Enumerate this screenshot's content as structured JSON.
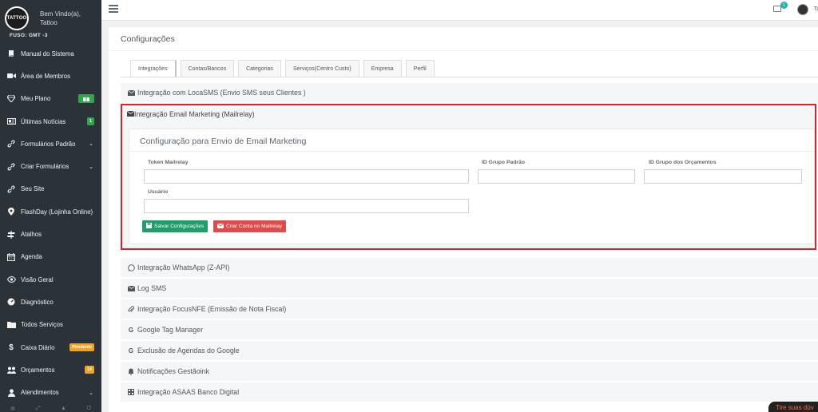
{
  "sidebar": {
    "logo_text": "TATTOO",
    "welcome_line1": "Bem Vindo(a),",
    "welcome_line2": "Tattoo",
    "timezone": "FUSO: GMT -3",
    "items": [
      {
        "label": "Manual do Sistema",
        "icon": "book-icon"
      },
      {
        "label": "Área de Membros",
        "icon": "video-icon"
      },
      {
        "label": "Meu Plano",
        "icon": "diamond-icon",
        "badge_icon": "gift-icon"
      },
      {
        "label": "Últimas Notícias",
        "icon": "newspaper-icon",
        "badge": "1"
      },
      {
        "label": "Formulários Padrão",
        "icon": "link-icon"
      },
      {
        "label": "Criar Formulários",
        "icon": "link-icon"
      },
      {
        "label": "Seu Site",
        "icon": "link-icon"
      },
      {
        "label": "FlashDay (Lojinha Online)",
        "icon": "map-marker-icon"
      },
      {
        "label": "Atalhos",
        "icon": "signpost-icon"
      },
      {
        "label": "Agenda",
        "icon": "calendar-icon"
      },
      {
        "label": "Visão Geral",
        "icon": "eye-icon"
      },
      {
        "label": "Diagnóstico",
        "icon": "gauge-icon"
      },
      {
        "label": "Todos Serviços",
        "icon": "folder-icon"
      },
      {
        "label": "Caixa Diário",
        "icon": "dollar-icon",
        "badge": "Pendente"
      },
      {
        "label": "Orçamentos",
        "icon": "users-icon",
        "badge": "14"
      },
      {
        "label": "Atendimentos",
        "icon": "user-icon"
      }
    ]
  },
  "topbar": {
    "mail_count": "1",
    "user_short": "Ta"
  },
  "page": {
    "title": "Configurações",
    "tabs": [
      "Integrações",
      "Contas/Bancos",
      "Categorias",
      "Serviços(Centro Custo)",
      "Empresa",
      "Perfil"
    ]
  },
  "sections": {
    "locasms": "Integração com LocaSMS (Envio SMS seus Clientes )",
    "mailrelay": "Integração Email Marketing (Mailrelay)",
    "whatsapp": "Integração WhatsApp (Z-API)",
    "logsms": "Log SMS",
    "focusnfe": "Integração FocusNFE (Emissão de Nota Fiscal)",
    "gtm": "Google Tag Manager",
    "google_agendas": "Exclusão de Agendas do Google",
    "notificacoes": "Notificações Gestãoink",
    "asaas": "Integração ASAAS Banco Digital"
  },
  "mailrelay_form": {
    "title": "Configuração para Envio de Email Marketing",
    "token_label": "Token Mailrelay",
    "grupo_padrao_label": "ID Grupo Padrão",
    "grupo_orcamentos_label": "ID Grupo dos Orçamentos",
    "usuario_label": "Usuário",
    "save_button": "Salvar Configurações",
    "create_button": "Criar Conta no Mailrelay"
  },
  "help_tab": "Tire suas dúv"
}
